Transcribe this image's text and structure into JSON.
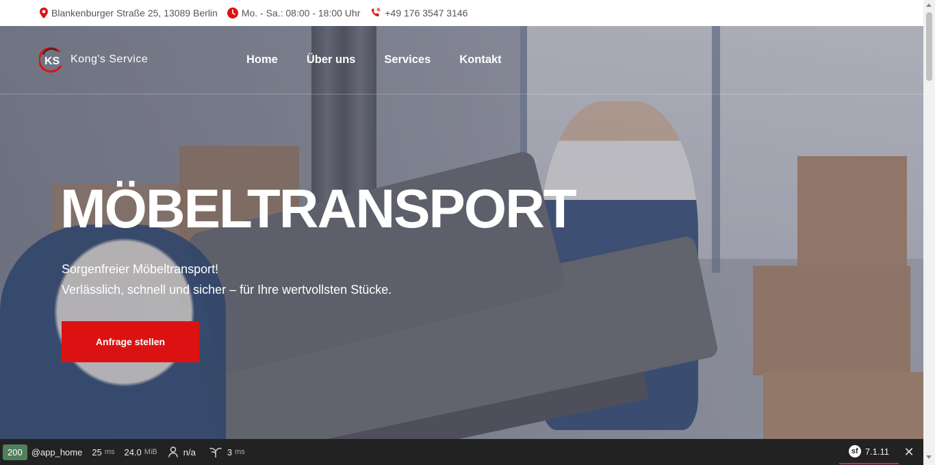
{
  "topbar": {
    "address": "Blankenburger Straße 25, 13089 Berlin",
    "hours": "Mo. - Sa.: 08:00 - 18:00 Uhr",
    "phone": "+49 176 3547 3146",
    "accent_color": "#dc1212"
  },
  "brand": {
    "logo_letters": "KS",
    "name": "Kong's Service"
  },
  "nav": {
    "items": [
      "Home",
      "Über uns",
      "Services",
      "Kontakt"
    ]
  },
  "hero": {
    "headline": "MÖBELTRANSPORT",
    "subline_1": "Sorgenfreier Möbeltransport!",
    "subline_2": "Verlässlich, schnell und sicher – für Ihre wertvollsten Stücke.",
    "cta_label": "Anfrage stellen",
    "cta_color": "#dc1212"
  },
  "debug_toolbar": {
    "status_code": "200",
    "route": "@app_home",
    "time_value": "25",
    "time_unit": "ms",
    "memory_value": "24.0",
    "memory_unit": "MiB",
    "user": "n/a",
    "twig_value": "3",
    "twig_unit": "ms",
    "symfony_version": "7.1.11"
  }
}
